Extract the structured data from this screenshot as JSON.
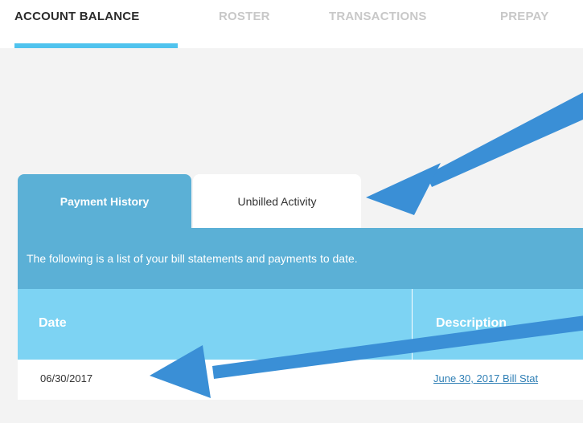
{
  "nav": {
    "tabs": [
      {
        "label": "ACCOUNT BALANCE",
        "active": true
      },
      {
        "label": "ROSTER",
        "active": false
      },
      {
        "label": "TRANSACTIONS",
        "active": false
      },
      {
        "label": "PREPAY",
        "active": false
      }
    ]
  },
  "subtabs": {
    "payment_history": "Payment History",
    "unbilled_activity": "Unbilled Activity"
  },
  "panel": {
    "info_text": "The following is a list of your bill statements and payments to date.",
    "columns": {
      "date": "Date",
      "description": "Description"
    },
    "rows": [
      {
        "date": "06/30/2017",
        "description": "June 30, 2017 Bill Stat"
      }
    ]
  },
  "colors": {
    "active_tab": "#5bb0d6",
    "header": "#7dd3f3",
    "underline": "#4fc3ee",
    "arrow": "#3a8fd6"
  }
}
